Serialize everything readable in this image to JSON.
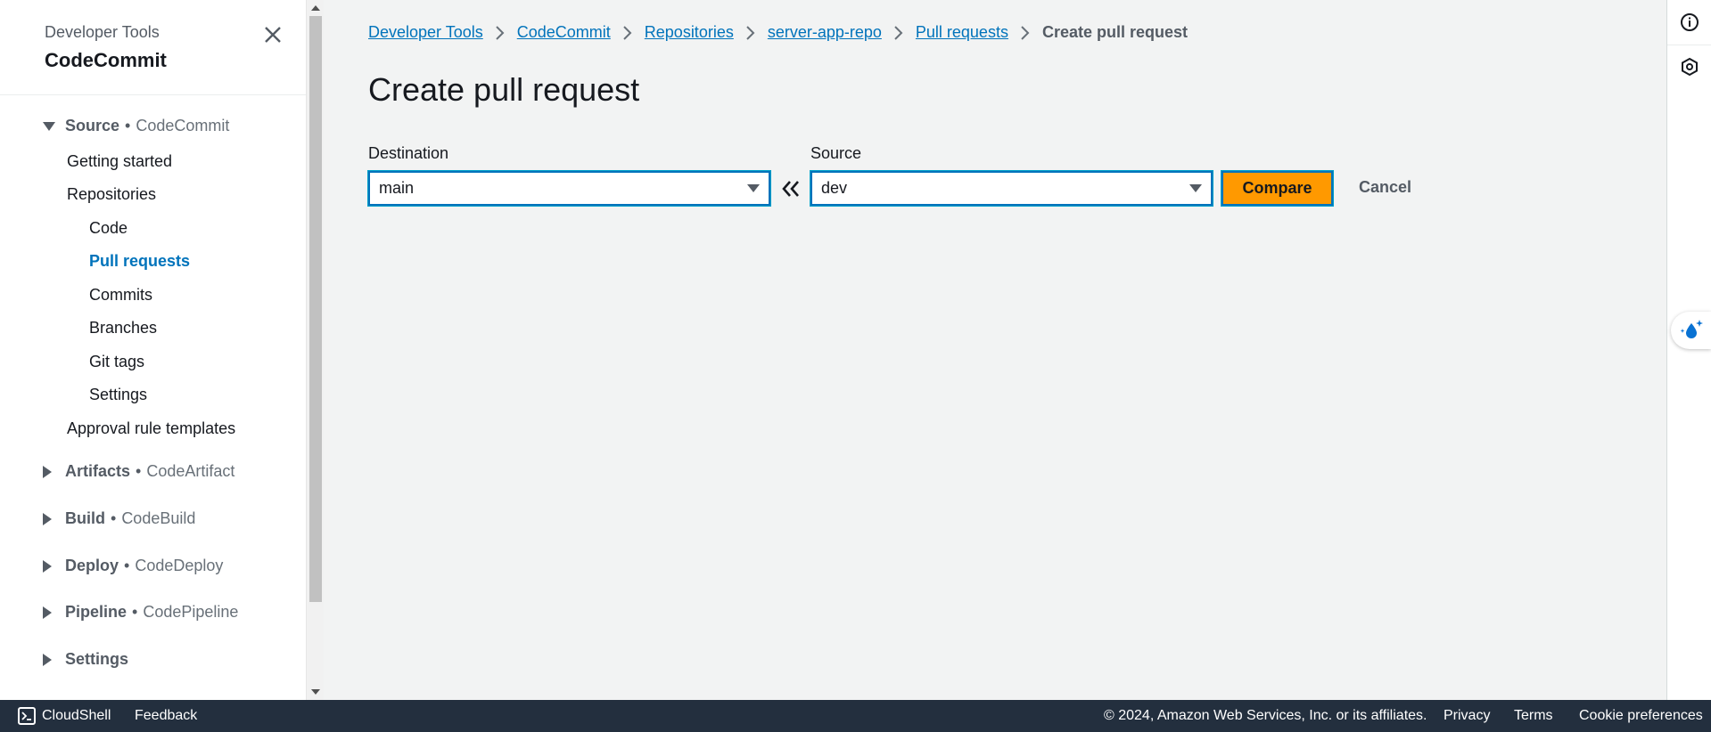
{
  "sidenav": {
    "subtitle": "Developer Tools",
    "title": "CodeCommit",
    "sections": [
      {
        "title": "Source",
        "service": "CodeCommit",
        "expanded": true
      },
      {
        "title": "Artifacts",
        "service": "CodeArtifact",
        "expanded": false
      },
      {
        "title": "Build",
        "service": "CodeBuild",
        "expanded": false
      },
      {
        "title": "Deploy",
        "service": "CodeDeploy",
        "expanded": false
      },
      {
        "title": "Pipeline",
        "service": "CodePipeline",
        "expanded": false
      },
      {
        "title": "Settings",
        "service": "",
        "expanded": false
      }
    ],
    "source_items": {
      "getting_started": "Getting started",
      "repositories": "Repositories",
      "code": "Code",
      "pull_requests": "Pull requests",
      "commits": "Commits",
      "branches": "Branches",
      "git_tags": "Git tags",
      "settings": "Settings",
      "approval_rule_templates": "Approval rule templates"
    },
    "separator": "•"
  },
  "breadcrumbs": [
    {
      "label": "Developer Tools"
    },
    {
      "label": "CodeCommit"
    },
    {
      "label": "Repositories"
    },
    {
      "label": "server-app-repo"
    },
    {
      "label": "Pull requests"
    },
    {
      "label": "Create pull request"
    }
  ],
  "page": {
    "title": "Create pull request",
    "destination_label": "Destination",
    "destination_value": "main",
    "source_label": "Source",
    "source_value": "dev",
    "compare_label": "Compare",
    "cancel_label": "Cancel"
  },
  "footer": {
    "cloudshell": "CloudShell",
    "feedback": "Feedback",
    "copyright": "© 2024, Amazon Web Services, Inc. or its affiliates.",
    "privacy": "Privacy",
    "terms": "Terms",
    "cookies": "Cookie preferences"
  },
  "colors": {
    "link": "#0073bb",
    "primary_button": "#ff9900",
    "footer_bg": "#232f3e",
    "page_bg": "#f2f3f3"
  },
  "icons": {
    "close": "close-icon",
    "caret_down": "caret-down-icon",
    "caret_right": "caret-right-icon",
    "breadcrumb_separator": "chevron-right-icon",
    "swap": "double-chevron-left-icon",
    "info": "info-icon",
    "settings": "hexagon-settings-icon",
    "assistant": "ai-assistant-icon",
    "cloudshell": "terminal-icon"
  }
}
